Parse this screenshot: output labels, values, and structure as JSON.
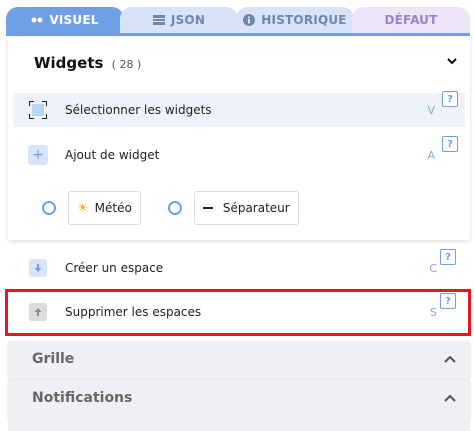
{
  "tabs": [
    {
      "label": "VISUEL",
      "icon": "eye-icon"
    },
    {
      "label": "JSON",
      "icon": "bars-icon"
    },
    {
      "label": "HISTORIQUE",
      "icon": "info-icon"
    },
    {
      "label": "DÉFAUT",
      "icon": ""
    }
  ],
  "widgets": {
    "title": "Widgets",
    "count": "( 28 )"
  },
  "actions": [
    {
      "label": "Sélectionner les widgets",
      "key": "V",
      "help": "?"
    },
    {
      "label": "Ajout de widget",
      "key": "A",
      "help": "?"
    },
    {
      "label": "Créer un espace",
      "key": "C",
      "help": "?"
    },
    {
      "label": "Supprimer les espaces",
      "key": "S",
      "help": "?"
    }
  ],
  "widget_options": [
    {
      "label": "Météo",
      "icon": "sun-icon"
    },
    {
      "label": "Séparateur",
      "icon": "dash-icon"
    }
  ],
  "sections": [
    {
      "title": "Grille"
    },
    {
      "title": "Notifications"
    }
  ],
  "colors": {
    "accent": "#6fa0e6",
    "highlight": "#e8171d"
  }
}
